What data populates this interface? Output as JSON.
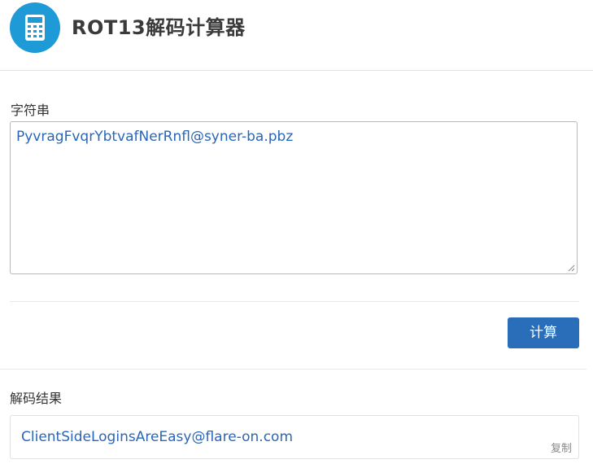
{
  "header": {
    "title": "ROT13解码计算器",
    "logo_icon": "calculator-icon",
    "accent_color": "#1e9ad6"
  },
  "input": {
    "label": "字符串",
    "value": "PyvragFvqrYbtvafNerRnfl@syner-ba.pbz"
  },
  "actions": {
    "calculate_label": "计算",
    "button_color": "#2a6db8"
  },
  "result": {
    "label": "解码结果",
    "value": "ClientSideLoginsAreEasy@flare-on.com",
    "copy_label": "复制"
  }
}
